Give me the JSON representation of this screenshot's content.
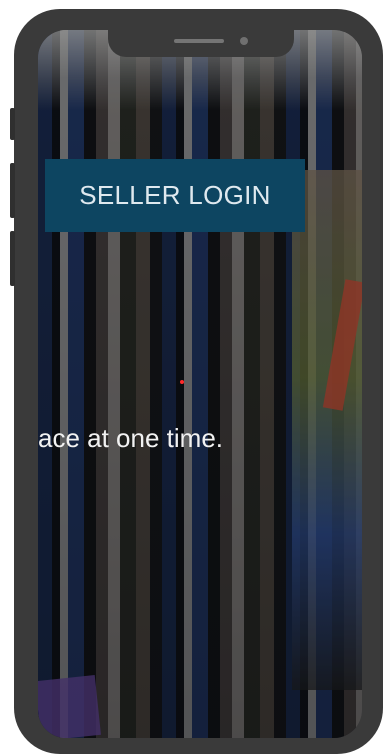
{
  "hero": {
    "login_button_label": "SELLER LOGIN",
    "tagline_visible": "ace at one time."
  },
  "colors": {
    "button_bg": "#0d4561",
    "button_text": "#dfe9ef",
    "phone_frame": "#3a3a3a",
    "indicator_dot": "#ff2a2a"
  },
  "icons": {
    "camera": "camera-icon",
    "speaker": "speaker-icon"
  }
}
